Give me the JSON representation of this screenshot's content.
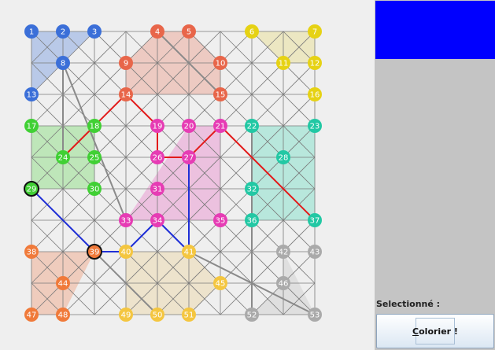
{
  "board": {
    "regions": [
      {
        "nodes": [
          1,
          13,
          8,
          3
        ],
        "color": "#3b6fd8"
      },
      {
        "nodes": [
          4,
          5,
          10,
          15,
          14,
          9
        ],
        "color": "#e8745a"
      },
      {
        "nodes": [
          6,
          7,
          12,
          11
        ],
        "color": "#e3d55a"
      },
      {
        "nodes": [
          17,
          18,
          30,
          29
        ],
        "color": "#4cd03c"
      },
      {
        "nodes": [
          20,
          21,
          35,
          33
        ],
        "color": "#e456b8"
      },
      {
        "nodes": [
          22,
          23,
          37,
          36
        ],
        "color": "#37d4ae"
      },
      {
        "nodes": [
          38,
          39,
          48,
          47
        ],
        "color": "#ef7a4a"
      },
      {
        "nodes": [
          40,
          41,
          45,
          51,
          49
        ],
        "color": "#e7c87a"
      },
      {
        "nodes": [
          46,
          42,
          53,
          52
        ],
        "color": "#b8b8b8"
      }
    ],
    "thick_edges": [
      [
        4,
        15
      ],
      [
        8,
        33
      ],
      [
        39,
        50
      ],
      [
        22,
        52
      ],
      [
        41,
        53
      ],
      [
        24,
        8
      ]
    ],
    "red_path": [
      [
        14,
        18
      ],
      [
        18,
        24
      ],
      [
        14,
        19
      ],
      [
        19,
        26
      ],
      [
        26,
        27
      ],
      [
        27,
        21
      ],
      [
        21,
        37
      ]
    ],
    "blue_path": [
      [
        29,
        39
      ],
      [
        39,
        40
      ],
      [
        40,
        34
      ],
      [
        34,
        41
      ],
      [
        41,
        27
      ]
    ],
    "nodes": [
      {
        "id": 1,
        "label": "1",
        "color": "#3b6fd8"
      },
      {
        "id": 2,
        "label": "2",
        "color": "#3b6fd8"
      },
      {
        "id": 3,
        "label": "3",
        "color": "#3b6fd8"
      },
      {
        "id": 4,
        "label": "4",
        "color": "#e8664a"
      },
      {
        "id": 5,
        "label": "5",
        "color": "#e8664a"
      },
      {
        "id": 6,
        "label": "6",
        "color": "#e6d214"
      },
      {
        "id": 7,
        "label": "7",
        "color": "#e6d214"
      },
      {
        "id": 8,
        "label": "8",
        "color": "#3b6fd8"
      },
      {
        "id": 9,
        "label": "9",
        "color": "#e8664a"
      },
      {
        "id": 10,
        "label": "10",
        "color": "#e8664a"
      },
      {
        "id": 11,
        "label": "11",
        "color": "#e6d214"
      },
      {
        "id": 12,
        "label": "12",
        "color": "#e6d214"
      },
      {
        "id": 13,
        "label": "13",
        "color": "#3b6fd8"
      },
      {
        "id": 14,
        "label": "14",
        "color": "#e8664a"
      },
      {
        "id": 15,
        "label": "15",
        "color": "#e8664a"
      },
      {
        "id": 16,
        "label": "16",
        "color": "#e6d214"
      },
      {
        "id": 17,
        "label": "17",
        "color": "#40d034"
      },
      {
        "id": 18,
        "label": "18",
        "color": "#40d034"
      },
      {
        "id": 19,
        "label": "19",
        "color": "#e63cb4"
      },
      {
        "id": 20,
        "label": "20",
        "color": "#e63cb4"
      },
      {
        "id": 21,
        "label": "21",
        "color": "#e63cb4"
      },
      {
        "id": 22,
        "label": "22",
        "color": "#22c8a4"
      },
      {
        "id": 23,
        "label": "23",
        "color": "#22c8a4"
      },
      {
        "id": 24,
        "label": "24",
        "color": "#40d034"
      },
      {
        "id": 25,
        "label": "25",
        "color": "#40d034"
      },
      {
        "id": 26,
        "label": "26",
        "color": "#e63cb4"
      },
      {
        "id": 27,
        "label": "27",
        "color": "#e63cb4"
      },
      {
        "id": 28,
        "label": "28",
        "color": "#22c8a4"
      },
      {
        "id": 29,
        "label": "29",
        "color": "#40d034"
      },
      {
        "id": 30,
        "label": "30",
        "color": "#40d034"
      },
      {
        "id": 31,
        "label": "31",
        "color": "#e63cb4"
      },
      {
        "id": 32,
        "label": "32",
        "color": "#22c8a4"
      },
      {
        "id": 33,
        "label": "33",
        "color": "#e63cb4"
      },
      {
        "id": 34,
        "label": "34",
        "color": "#e63cb4"
      },
      {
        "id": 35,
        "label": "35",
        "color": "#e63cb4"
      },
      {
        "id": 36,
        "label": "36",
        "color": "#22c8a4"
      },
      {
        "id": 37,
        "label": "37",
        "color": "#22c8a4"
      },
      {
        "id": 38,
        "label": "38",
        "color": "#f07a3a"
      },
      {
        "id": 39,
        "label": "39",
        "color": "#f07a3a"
      },
      {
        "id": 40,
        "label": "40",
        "color": "#f4c640"
      },
      {
        "id": 41,
        "label": "41",
        "color": "#f4c640"
      },
      {
        "id": 42,
        "label": "42",
        "color": "#aaaaaa"
      },
      {
        "id": 43,
        "label": "43",
        "color": "#aaaaaa"
      },
      {
        "id": 44,
        "label": "44",
        "color": "#f07a3a"
      },
      {
        "id": 45,
        "label": "45",
        "color": "#f4c640"
      },
      {
        "id": 46,
        "label": "46",
        "color": "#aaaaaa"
      },
      {
        "id": 47,
        "label": "47",
        "color": "#f07a3a"
      },
      {
        "id": 48,
        "label": "48",
        "color": "#f07a3a"
      },
      {
        "id": 49,
        "label": "49",
        "color": "#f4c640"
      },
      {
        "id": 50,
        "label": "50",
        "color": "#f4c640"
      },
      {
        "id": 51,
        "label": "51",
        "color": "#f4c640"
      },
      {
        "id": 52,
        "label": "52",
        "color": "#aaaaaa"
      },
      {
        "id": 53,
        "label": "53",
        "color": "#aaaaaa"
      }
    ],
    "selected_nodes": [
      29,
      39
    ]
  },
  "sidebar": {
    "current_color": "#0000ff",
    "selected_label": "Selectionné :",
    "button_label": "Colorier !"
  }
}
